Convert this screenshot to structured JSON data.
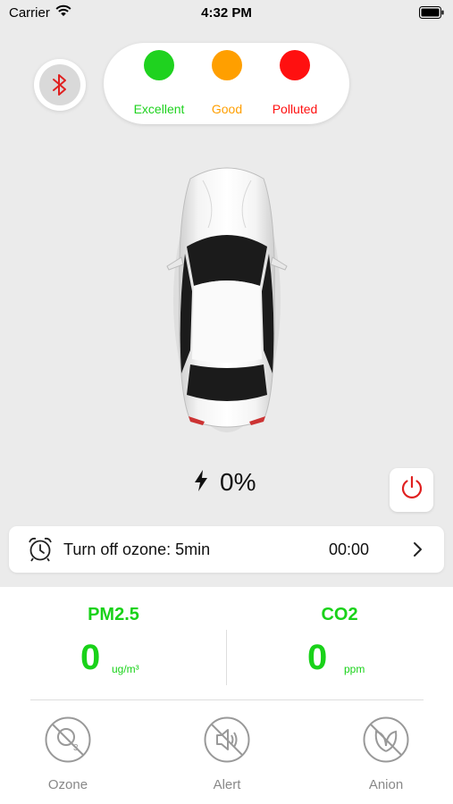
{
  "status_bar": {
    "carrier": "Carrier",
    "time": "4:32 PM"
  },
  "bluetooth": {
    "icon": "bluetooth-icon",
    "color": "#e02020"
  },
  "legend": [
    {
      "label": "Excellent",
      "color": "#1fd21f"
    },
    {
      "label": "Good",
      "color": "#ff9f00"
    },
    {
      "label": "Polluted",
      "color": "#ff1010"
    }
  ],
  "charge": {
    "icon": "lightning-icon",
    "value": "0%"
  },
  "power": {
    "icon": "power-icon",
    "color": "#e02020"
  },
  "timer": {
    "icon": "alarm-clock-icon",
    "label": "Turn off ozone: 5min",
    "value": "00:00"
  },
  "metrics": [
    {
      "name": "PM2.5",
      "value": "0",
      "unit": "ug/m³"
    },
    {
      "name": "CO2",
      "value": "0",
      "unit": "ppm"
    }
  ],
  "actions": [
    {
      "label": "Ozone",
      "icon": "ozone-off-icon"
    },
    {
      "label": "Alert",
      "icon": "speaker-off-icon"
    },
    {
      "label": "Anion",
      "icon": "leaf-off-icon"
    }
  ],
  "colors": {
    "accent_green": "#19d219",
    "muted": "#888888"
  }
}
